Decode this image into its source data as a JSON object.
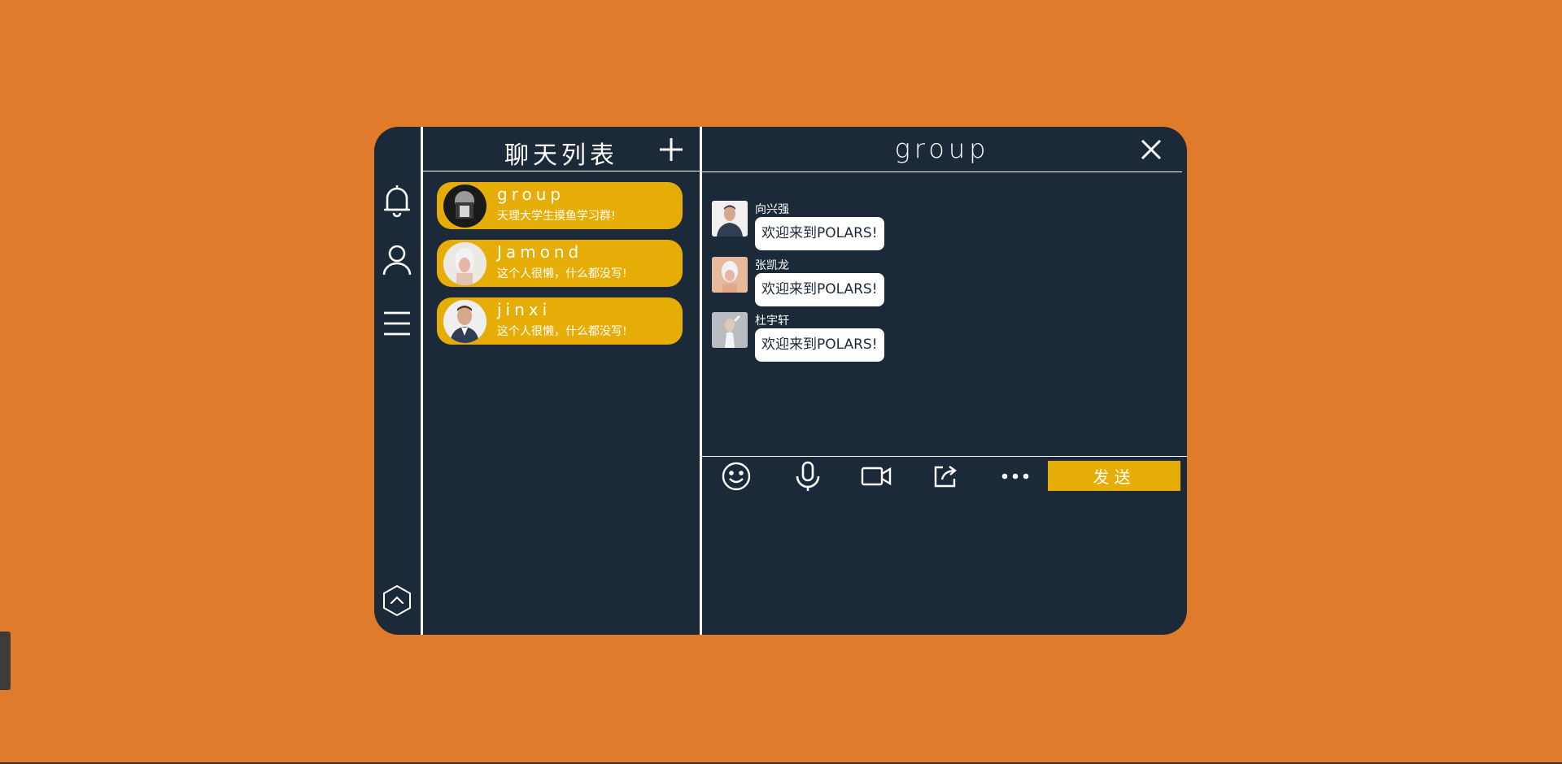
{
  "sidebar": {
    "items": [
      {
        "name": "bell-icon"
      },
      {
        "name": "user-icon"
      },
      {
        "name": "menu-icon"
      }
    ],
    "bottom_icon": "chevron-up-hexagon-icon"
  },
  "chat_list": {
    "title": "聊天列表",
    "items": [
      {
        "name": "group",
        "signature": "天理大学生摸鱼学习群!"
      },
      {
        "name": "Jamond",
        "signature": "这个人很懒，什么都没写!"
      },
      {
        "name": "jinxi",
        "signature": "这个人很懒，什么都没写!"
      }
    ]
  },
  "chat": {
    "title": "group",
    "messages": [
      {
        "sender": "向兴强",
        "text": "欢迎来到POLARS!"
      },
      {
        "sender": "张凯龙",
        "text": "欢迎来到POLARS!"
      },
      {
        "sender": "杜宇轩",
        "text": "欢迎来到POLARS!"
      }
    ],
    "toolbar": [
      "smile-icon",
      "microphone-icon",
      "video-icon",
      "share-icon",
      "more-icon"
    ],
    "send_label": "发送",
    "input_value": ""
  },
  "colors": {
    "background": "#df7b2b",
    "panel": "#1c2939",
    "accent": "#e6ad06",
    "text": "#ffffff"
  }
}
